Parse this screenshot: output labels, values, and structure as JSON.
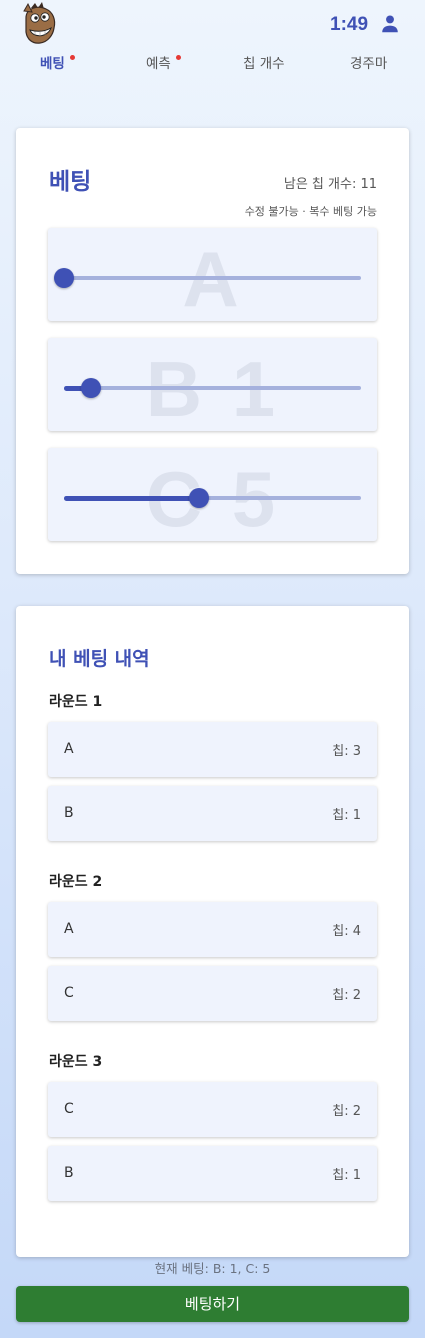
{
  "header": {
    "time": "1:49",
    "logo_icon": "horse-mascot-icon",
    "user_icon": "person-icon"
  },
  "tabs": [
    {
      "label": "베팅",
      "active": true,
      "badge": true
    },
    {
      "label": "예측",
      "active": false,
      "badge": true
    },
    {
      "label": "칩 개수",
      "active": false,
      "badge": false
    },
    {
      "label": "경주마",
      "active": false,
      "badge": false
    }
  ],
  "betting": {
    "title": "베팅",
    "remaining_label": "남은 칩 개수: 11",
    "note": "수정 불가능 · 복수 베팅 가능",
    "sliders": [
      {
        "watermark": "A",
        "value": 0,
        "max": 11
      },
      {
        "watermark": "B 1",
        "value": 1,
        "max": 11
      },
      {
        "watermark": "C 5",
        "value": 5,
        "max": 11
      }
    ]
  },
  "history": {
    "title": "내 베팅 내역",
    "rounds": [
      {
        "label": "라운드 1",
        "bets": [
          {
            "horse": "A",
            "chips": "칩: 3"
          },
          {
            "horse": "B",
            "chips": "칩: 1"
          }
        ]
      },
      {
        "label": "라운드 2",
        "bets": [
          {
            "horse": "A",
            "chips": "칩: 4"
          },
          {
            "horse": "C",
            "chips": "칩: 2"
          }
        ]
      },
      {
        "label": "라운드 3",
        "bets": [
          {
            "horse": "C",
            "chips": "칩: 2"
          },
          {
            "horse": "B",
            "chips": "칩: 1"
          }
        ]
      }
    ]
  },
  "footer": {
    "current_bet": "현재 베팅: B: 1, C: 5",
    "button_label": "베팅하기"
  },
  "colors": {
    "primary": "#3f51b5",
    "action": "#2e7d32",
    "badge": "#e53935"
  }
}
